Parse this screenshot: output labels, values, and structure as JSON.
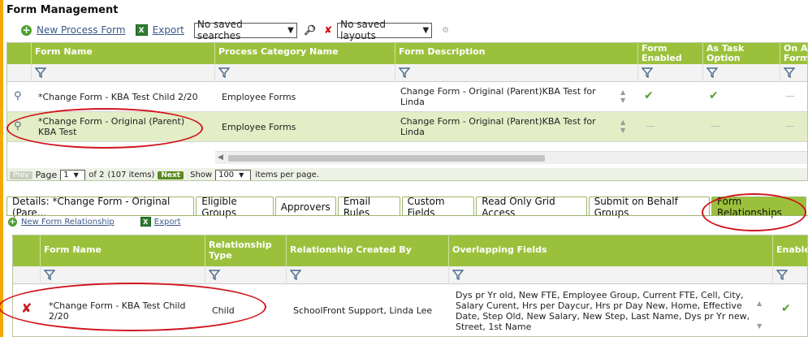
{
  "page_title": "Form Management",
  "toolbar": {
    "new_process_form": "New Process Form",
    "export": "Export",
    "saved_searches": "No saved searches",
    "saved_layouts": "No saved layouts"
  },
  "grid1": {
    "columns": [
      "Form Name",
      "Process Category Name",
      "Form Description",
      "Form Enabled",
      "As Task Option",
      "On A Form"
    ],
    "rows": [
      {
        "name": "*Change Form - KBA Test Child 2/20",
        "category": "Employee Forms",
        "description": "Change Form - Original (Parent)KBA Test for Linda",
        "enabled": "check",
        "task": "check",
        "onform": "dash"
      },
      {
        "name": "*Change Form - Original (Parent) KBA Test",
        "category": "Employee Forms",
        "description": "Change Form - Original (Parent)KBA Test for Linda",
        "enabled": "dash",
        "task": "dash",
        "onform": "dash"
      }
    ],
    "pager": {
      "prev": "Prev",
      "page_label": "Page",
      "page_value": "1",
      "of_text": "of 2",
      "items_text": "(107 items)",
      "next": "Next",
      "show_label": "Show",
      "show_value": "100",
      "per_page_text": "items per page."
    }
  },
  "tabs": [
    "Details: *Change Form - Original (Pare...",
    "Eligible Groups",
    "Approvers",
    "Email Rules",
    "Custom Fields",
    "Read Only Grid Access",
    "Submit on Behalf Groups",
    "Form Relationships"
  ],
  "subtoolbar": {
    "new_relationship": "New Form Relationship",
    "export": "Export"
  },
  "grid2": {
    "columns": [
      "Form Name",
      "Relationship Type",
      "Relationship Created By",
      "Overlapping Fields",
      "Enable"
    ],
    "rows": [
      {
        "name": "*Change Form - KBA Test Child 2/20",
        "type": "Child",
        "created_by": "SchoolFront Support, Linda Lee",
        "fields": "Dys pr Yr old, New FTE, Employee Group, Current FTE, Cell, City, Salary Curent, Hrs per Daycur, Hrs pr Day New, Home, Effective Date, Step Old, New Salary, New Step, Last Name, Dys pr Yr new, Street, 1st Name",
        "enabled": "check"
      }
    ]
  },
  "colors": {
    "header_green": "#9bc13c",
    "selected_row": "#e3edc6",
    "annotation_red": "#d0151c"
  }
}
